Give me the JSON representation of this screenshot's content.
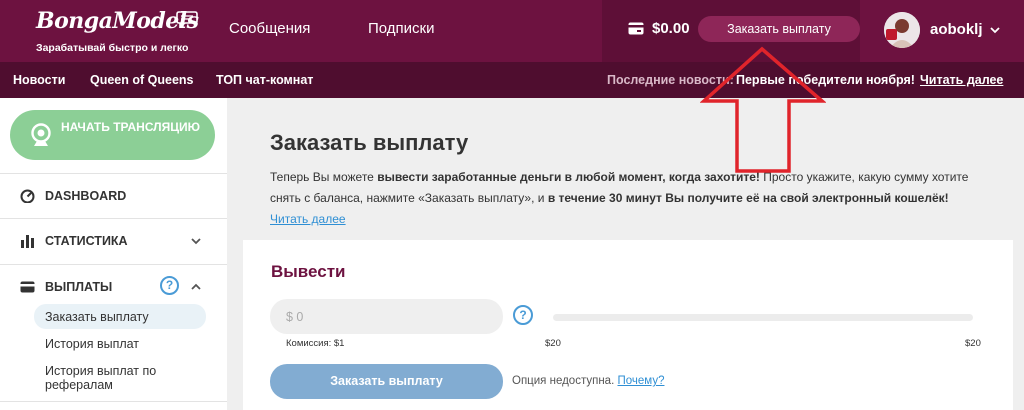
{
  "brand": {
    "logo_text": "BongaModels",
    "tagline": "Зарабатывай быстро и легко"
  },
  "header": {
    "nav": [
      "Сообщения",
      "Подписки"
    ],
    "balance": "$0.00",
    "payout_button": "Заказать выплату",
    "username": "aoboklj"
  },
  "subnav": {
    "links": [
      "Новости",
      "Queen of Queens",
      "ТОП чат-комнат"
    ],
    "news_label": "Последние новости:",
    "news_text": "Первые победители ноября!",
    "news_more": "Читать далее"
  },
  "sidebar": {
    "start_button": "НАЧАТЬ ТРАНСЛЯЦИЮ",
    "items": [
      {
        "label": "DASHBOARD",
        "icon": "gauge-icon"
      },
      {
        "label": "СТАТИСТИКА",
        "icon": "bar-chart-icon"
      },
      {
        "label": "ВЫПЛАТЫ",
        "icon": "credit-card-icon"
      }
    ],
    "help_symbol": "?",
    "payout_subitems": [
      "Заказать выплату",
      "История выплат",
      "История выплат по рефералам"
    ]
  },
  "main": {
    "title": "Заказать выплату",
    "intro": {
      "p1": "Теперь Вы можете ",
      "b1": "вывести заработанные деньги в любой момент, когда захотите!",
      "p2": " Просто укажите, какую сумму хотите снять с баланса, нажмите «Заказать выплату», и ",
      "b2": "в течение 30 минут Вы получите её на свой электронный кошелёк!",
      "link": "Читать далее"
    },
    "withdraw": {
      "title": "Вывести",
      "amount_placeholder": "$ 0",
      "help_symbol": "?",
      "commission": "Комиссия: $1",
      "slider_min": "$20",
      "slider_max": "$20",
      "submit": "Заказать выплату",
      "unavailable": "Опция недоступна.",
      "why": "Почему?"
    }
  },
  "colors": {
    "header_bg": "#6d1240",
    "subnav_bg": "#4f0d2f",
    "start_button": "#8ccf96",
    "submit_button": "#82acd2",
    "link": "#2f8fd4",
    "annotation_arrow": "#e0242b"
  }
}
